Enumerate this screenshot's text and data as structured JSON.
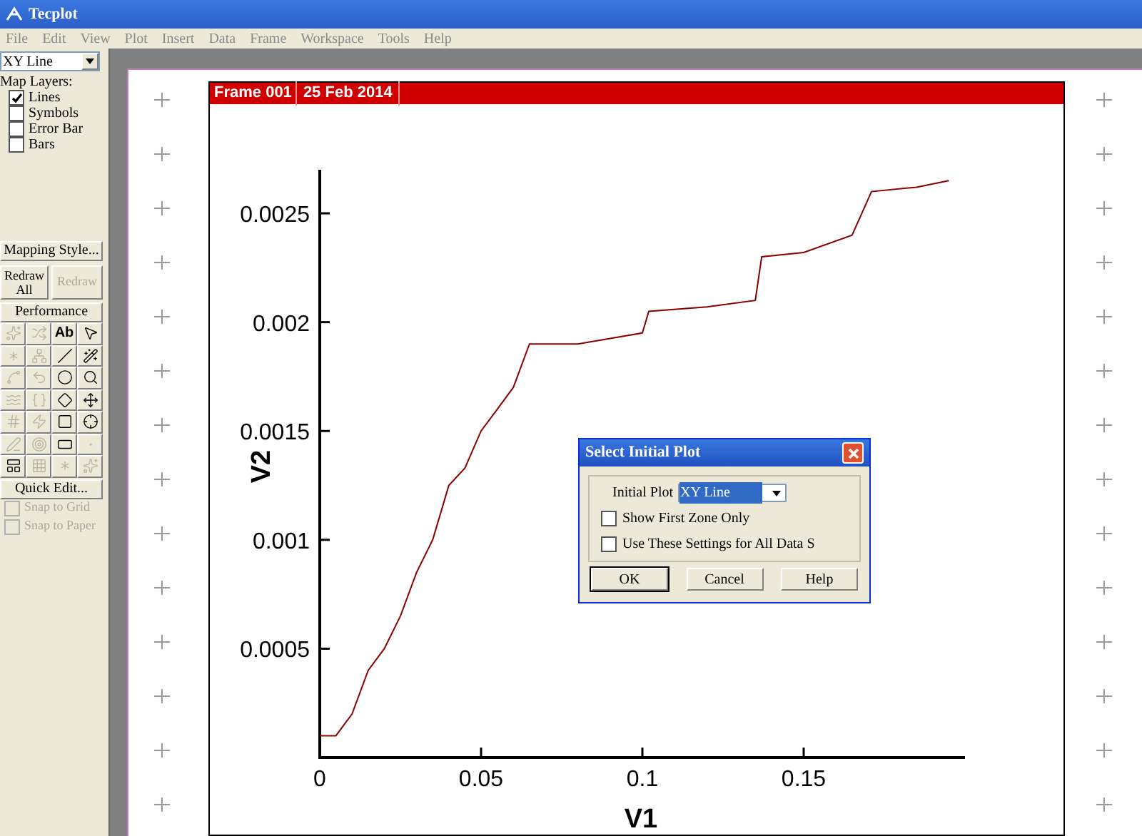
{
  "window": {
    "title": "Tecplot"
  },
  "menu": [
    "File",
    "Edit",
    "View",
    "Plot",
    "Insert",
    "Data",
    "Frame",
    "Workspace",
    "Tools",
    "Help"
  ],
  "sidebar": {
    "plot_type": "XY Line",
    "layers_label": "Map Layers:",
    "layers": [
      {
        "label": "Lines",
        "checked": true
      },
      {
        "label": "Symbols",
        "checked": false
      },
      {
        "label": "Error Bar",
        "checked": false
      },
      {
        "label": "Bars",
        "checked": false
      }
    ],
    "mapping_button": "Mapping Style...",
    "redraw_all": "Redraw All",
    "redraw": {
      "label": "Redraw",
      "disabled": true
    },
    "performance": "Performance",
    "tools": [
      {
        "disabled": true
      },
      {
        "disabled": true
      },
      {
        "label": "Ab",
        "disabled": false
      },
      {
        "disabled": false
      },
      {
        "disabled": true
      },
      {
        "disabled": true
      },
      {
        "disabled": false
      },
      {
        "disabled": false
      },
      {
        "disabled": true
      },
      {
        "disabled": true
      },
      {
        "disabled": false
      },
      {
        "disabled": false
      },
      {
        "disabled": true
      },
      {
        "disabled": true
      },
      {
        "disabled": false
      },
      {
        "disabled": false
      },
      {
        "disabled": true
      },
      {
        "disabled": true
      },
      {
        "disabled": false
      },
      {
        "disabled": false
      },
      {
        "disabled": true
      },
      {
        "disabled": true
      },
      {
        "disabled": false
      },
      {
        "disabled": true
      },
      {
        "disabled": false
      },
      {
        "disabled": true
      },
      {
        "disabled": true
      },
      {
        "disabled": true
      }
    ],
    "quick_edit": "Quick Edit...",
    "snaps": [
      {
        "label": "Snap to Grid",
        "checked": false,
        "disabled": true
      },
      {
        "label": "Snap to Paper",
        "checked": false,
        "disabled": true
      }
    ]
  },
  "frame": {
    "name": "Frame 001",
    "date": "25 Feb 2014",
    "chart_data": {
      "type": "line",
      "xlabel": "V1",
      "ylabel": "V2",
      "xlim": [
        0,
        0.2
      ],
      "ylim": [
        0,
        0.0027
      ],
      "xticks": [
        0,
        0.05,
        0.1,
        0.15
      ],
      "yticks": [
        0.0005,
        0.001,
        0.0015,
        0.002,
        0.0025
      ],
      "x": [
        0,
        0.005,
        0.01,
        0.015,
        0.02,
        0.025,
        0.03,
        0.035,
        0.04,
        0.045,
        0.05,
        0.055,
        0.06,
        0.065,
        0.08,
        0.1,
        0.102,
        0.12,
        0.135,
        0.137,
        0.15,
        0.165,
        0.171,
        0.185,
        0.195
      ],
      "series": [
        {
          "color": "#8b0000",
          "values": [
            0.0001,
            0.0001,
            0.0002,
            0.0004,
            0.0005,
            0.00065,
            0.00085,
            0.001,
            0.00125,
            0.00133,
            0.0015,
            0.0016,
            0.0017,
            0.0019,
            0.0019,
            0.00195,
            0.00205,
            0.00207,
            0.0021,
            0.0023,
            0.00232,
            0.0024,
            0.0026,
            0.00262,
            0.00265
          ]
        }
      ]
    }
  },
  "dialog": {
    "title": "Select Initial Plot",
    "initial_label": "Initial Plot",
    "initial_value": "XY Line",
    "options": [
      {
        "label": "Show First Zone Only",
        "checked": false
      },
      {
        "label": "Use These Settings for All Data S",
        "checked": false
      }
    ],
    "buttons": [
      "OK",
      "Cancel",
      "Help"
    ]
  }
}
